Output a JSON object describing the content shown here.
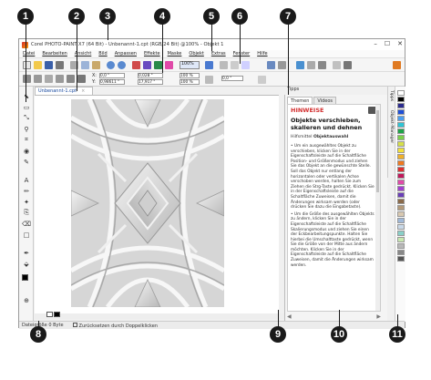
{
  "window": {
    "title": "Corel PHOTO-PAINT X7 (64 Bit) - Unbenannt-1.cpt (RGB/24 Bit) @100% - Objekt 1",
    "controls": [
      "–",
      "☐",
      "✕"
    ]
  },
  "menu": [
    "Datei",
    "Bearbeiten",
    "Ansicht",
    "Bild",
    "Anpassen",
    "Effekte",
    "Maske",
    "Objekt",
    "Extras",
    "Fenster",
    "Hilfe"
  ],
  "property_bar": {
    "x_label": "X:",
    "x_value": "0,0 \"",
    "y_label": "Y:",
    "y_value": "0,98611 \"",
    "width_value": "0,028 \"",
    "height_value": "17,917 \"",
    "scale_w": "100 %",
    "scale_h": "100 %",
    "zoom": "100%",
    "angle": "0,0 °"
  },
  "document_tab": {
    "label": "Unbenannt-1.cpt",
    "close": "×"
  },
  "docker": {
    "title": "Tipps",
    "tabs": [
      "Themen",
      "Videos"
    ],
    "heading": "HINWEISE",
    "topic_title": "Objekte verschieben, skalieren und dehnen",
    "tool_line_prefix": "Hilfsmittel ",
    "tool_line_bold": "Objektauswahl",
    "paragraphs": [
      "• Um ein ausgewähltes Objekt zu verschieben, klicken Sie in der Eigenschaftsleiste auf die Schaltfläche Position- und Größenmodus und ziehen Sie das Objekt an die gewünschte Stelle. Soll das Objekt nur entlang der horizontalen oder vertikalen Achse verschoben werden, halten Sie zum Ziehen die Strg-Taste gedrückt. Klicken Sie in der Eigenschaftsleiste auf die Schaltfläche Zuweisen, damit die Änderungen wirksam werden (oder drücken Sie dazu die Eingabetaste).",
      "• Um die Größe des ausgewählten Objekts zu ändern, klicken Sie in der Eigenschaftsleiste auf die Schaltfläche Skalierungsmodus und ziehen Sie einen der Eckbearbeitungspunkte. Halten Sie hierbei die Umschalttaste gedrückt, wenn Sie die Größe von der Mitte aus ändern möchten. Klicken Sie in der Eigenschaftsleiste auf die Schaltfläche Zuweisen, damit die Änderungen wirksam werden."
    ]
  },
  "side_tabs": [
    "Tipps",
    "Objekt-Manager"
  ],
  "status": {
    "file_size": "Dateigröße 0 Byte",
    "hint": "Zurücksetzen durch Doppelklicken"
  },
  "callouts": [
    "1",
    "2",
    "3",
    "4",
    "5",
    "6",
    "7",
    "8",
    "9",
    "10",
    "11"
  ],
  "palette_colors": [
    "#ffffff",
    "#000000",
    "#2b2b8f",
    "#1e4fd8",
    "#4b9ef0",
    "#2ec5d6",
    "#1ea34a",
    "#7ad14a",
    "#d6e04a",
    "#f2e23a",
    "#f0b02a",
    "#ef7a21",
    "#e02f2f",
    "#c2185b",
    "#e04aa8",
    "#a33fd0",
    "#6a3fb8",
    "#8a6a4a",
    "#b39a7a",
    "#d8c8b0",
    "#9fb8d8",
    "#c8d8e8",
    "#8ad0c8",
    "#c8e8b0",
    "#b8b8b8",
    "#888888",
    "#555555"
  ],
  "accent": "#d32f2f"
}
